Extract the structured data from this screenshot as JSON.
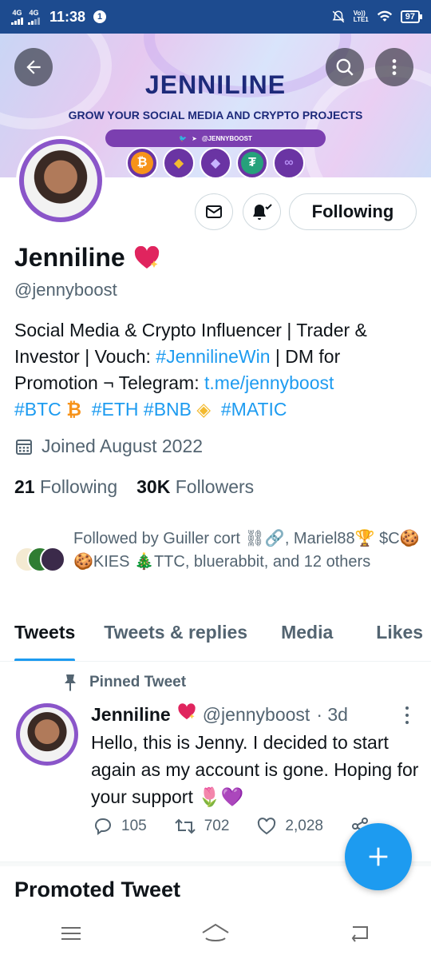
{
  "status_bar": {
    "signal_1": "4G",
    "signal_2": "4G",
    "time": "11:38",
    "notification_count": "1",
    "volte": "Vo))\nLTE1",
    "battery": "97"
  },
  "banner": {
    "title": "JENNILINE",
    "subtitle": "GROW YOUR SOCIAL MEDIA AND CRYPTO PROJECTS",
    "social_handle": "@JENNYBOOST",
    "coins": [
      "₿",
      "◆",
      "◆",
      "₮",
      "∞"
    ]
  },
  "profile": {
    "name": "Jenniline",
    "handle": "@jennyboost",
    "bio": {
      "part1": "Social Media & Crypto Influencer | Trader & Investor | Vouch: ",
      "hashtag_win": "#JennilineWin",
      "part2": " | DM for Promotion ¬ Telegram: ",
      "telegram_link": "t.me/jennyboost",
      "tag_btc": "#BTC",
      "tag_eth": "#ETH",
      "tag_bnb": "#BNB",
      "tag_matic": "#MATIC"
    },
    "joined": "Joined August 2022",
    "following_count": "21",
    "following_label": "Following",
    "followers_count": "30K",
    "followers_label": "Followers",
    "followed_by": "Followed by Guiller cort ⛓🔗, Mariel88🏆 $C🍪🍪KIES 🎄TTC, bluerabbit, and 12 others"
  },
  "actions": {
    "following_button": "Following"
  },
  "tabs": [
    "Tweets",
    "Tweets & replies",
    "Media",
    "Likes"
  ],
  "pinned_tweet": {
    "label": "Pinned Tweet",
    "author": "Jenniline",
    "handle": "@jennyboost",
    "time": "· 3d",
    "text": "Hello, this is Jenny. I decided to start again as my account is gone. Hoping for your support 🌷💜",
    "replies": "105",
    "retweets": "702",
    "likes": "2,028"
  },
  "promoted": {
    "label": "Promoted Tweet"
  },
  "colors": {
    "accent": "#1d9bf0",
    "status_bar": "#1d4b8f",
    "banner_purple": "#6a34a3",
    "text_secondary": "#536471"
  }
}
